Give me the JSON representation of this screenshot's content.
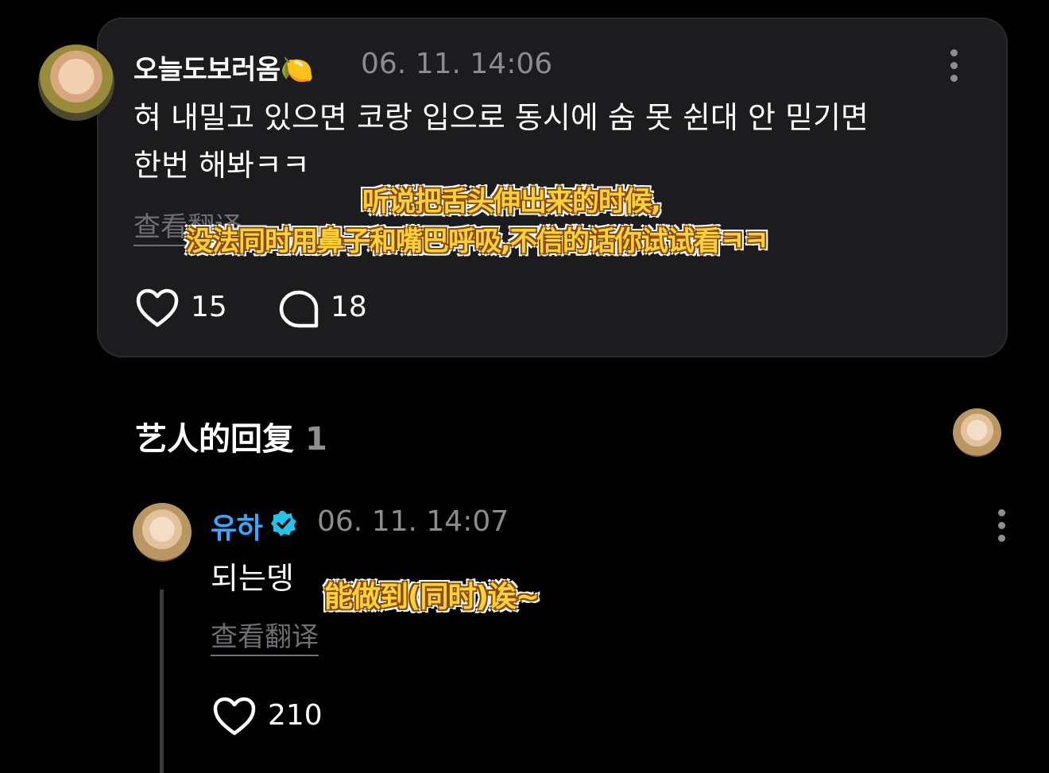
{
  "comment": {
    "username": "오늘도보러옴🍋",
    "timestamp": "06. 11. 14:06",
    "text_line1": "혀 내밀고 있으면 코랑 입으로 동시에 숨 못 쉰대 안 믿기면",
    "text_line2": "한번 해봐ㅋㅋ",
    "translate_label": "查看翻译",
    "likes": "15",
    "replies": "18"
  },
  "caption_top": {
    "line1": "听说把舌头伸出来的时候,",
    "line2": "没法同时用鼻子和嘴巴呼吸,不信的话你试试看ㅋㅋ"
  },
  "artist_reply": {
    "section_title": "艺人的回复",
    "section_count": "1",
    "username": "유하",
    "timestamp": "06. 11. 14:07",
    "text": "되는뎅",
    "translate_label": "查看翻译",
    "likes": "210"
  },
  "caption_bottom": {
    "line1": "能做到(同时)诶~"
  },
  "colors": {
    "background": "#000000",
    "card": "#1c1c1e",
    "artist_name": "#3aa7ff",
    "verified": "#22c3e6",
    "caption_fill": "#ffd23a"
  },
  "icons": [
    "heart-icon",
    "comment-bubble-icon",
    "more-options-icon",
    "verified-badge-icon"
  ]
}
